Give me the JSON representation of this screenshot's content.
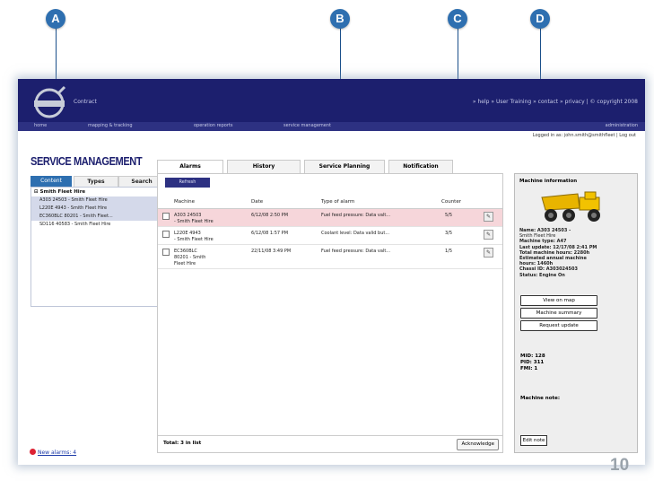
{
  "callouts": [
    "A",
    "B",
    "C",
    "D"
  ],
  "header": {
    "app_name": "Contract",
    "top_links": "» help » User Training » contact » privacy | © copyright 2008"
  },
  "nav": {
    "items": [
      "home",
      "mapping & tracking",
      "operation reports",
      "service management"
    ],
    "admin": "administration",
    "login": "Logged in as: john.smith@smithfleet | Log out"
  },
  "page_title": "SERVICE MANAGEMENT",
  "left_tabs": [
    "Content",
    "Types",
    "Search"
  ],
  "tree": {
    "root": "⊟ Smith Fleet Hire",
    "items": [
      "A303 24503 - Smith Fleet Hire",
      "L220E 4943 - Smith Fleet Hire",
      "EC360BLC 80201 - Smith Fleet...",
      "SD116 40583 - Smith Fleet Hire"
    ]
  },
  "new_alarms": "New alarms: 4",
  "main_tabs": [
    "Alarms",
    "History",
    "Service Planning",
    "Notification"
  ],
  "refresh_label": "Refresh",
  "table": {
    "headers": [
      "Machine",
      "Date",
      "Type of alarm",
      "Counter"
    ],
    "rows": [
      {
        "machine": "A303 24503\n- Smith Fleet Hire",
        "date": "6/12/08 2:50 PM",
        "type": "Fuel feed pressure: Data valt...",
        "counter": "5/5",
        "highlight": true
      },
      {
        "machine": "L220E 4943\n- Smith Fleet Hire",
        "date": "6/12/08 1:57 PM",
        "type": "Coolant level: Data valid but...",
        "counter": "3/5",
        "highlight": false
      },
      {
        "machine": "EC360BLC\n80201 - Smith\nFleet Hire",
        "date": "22/11/08 3:49 PM",
        "type": "Fuel feed pressure: Data valt...",
        "counter": "1/5",
        "highlight": false
      }
    ]
  },
  "footer": {
    "total": "Total: 3 in list",
    "ack": "Acknowledge"
  },
  "right": {
    "title": "Machine information",
    "info_lines": [
      "Name: A303 24503 -",
      "Smith Fleet Hire",
      "Machine type: A47",
      "Last update: 12/17/08 2:41 PM",
      "Total machine hours: 2280h",
      "Estimated annual machine",
      "hours: 1460h",
      "Chassi ID: A303024503",
      "Status: Engine On"
    ],
    "buttons": [
      "View on map",
      "Machine summary",
      "Request update"
    ],
    "stats": [
      "MID: 128",
      "PID: 311",
      "FMI: 1"
    ],
    "notes_label": "Machine note:",
    "edit_note": "Edit note"
  },
  "page_number": "10"
}
